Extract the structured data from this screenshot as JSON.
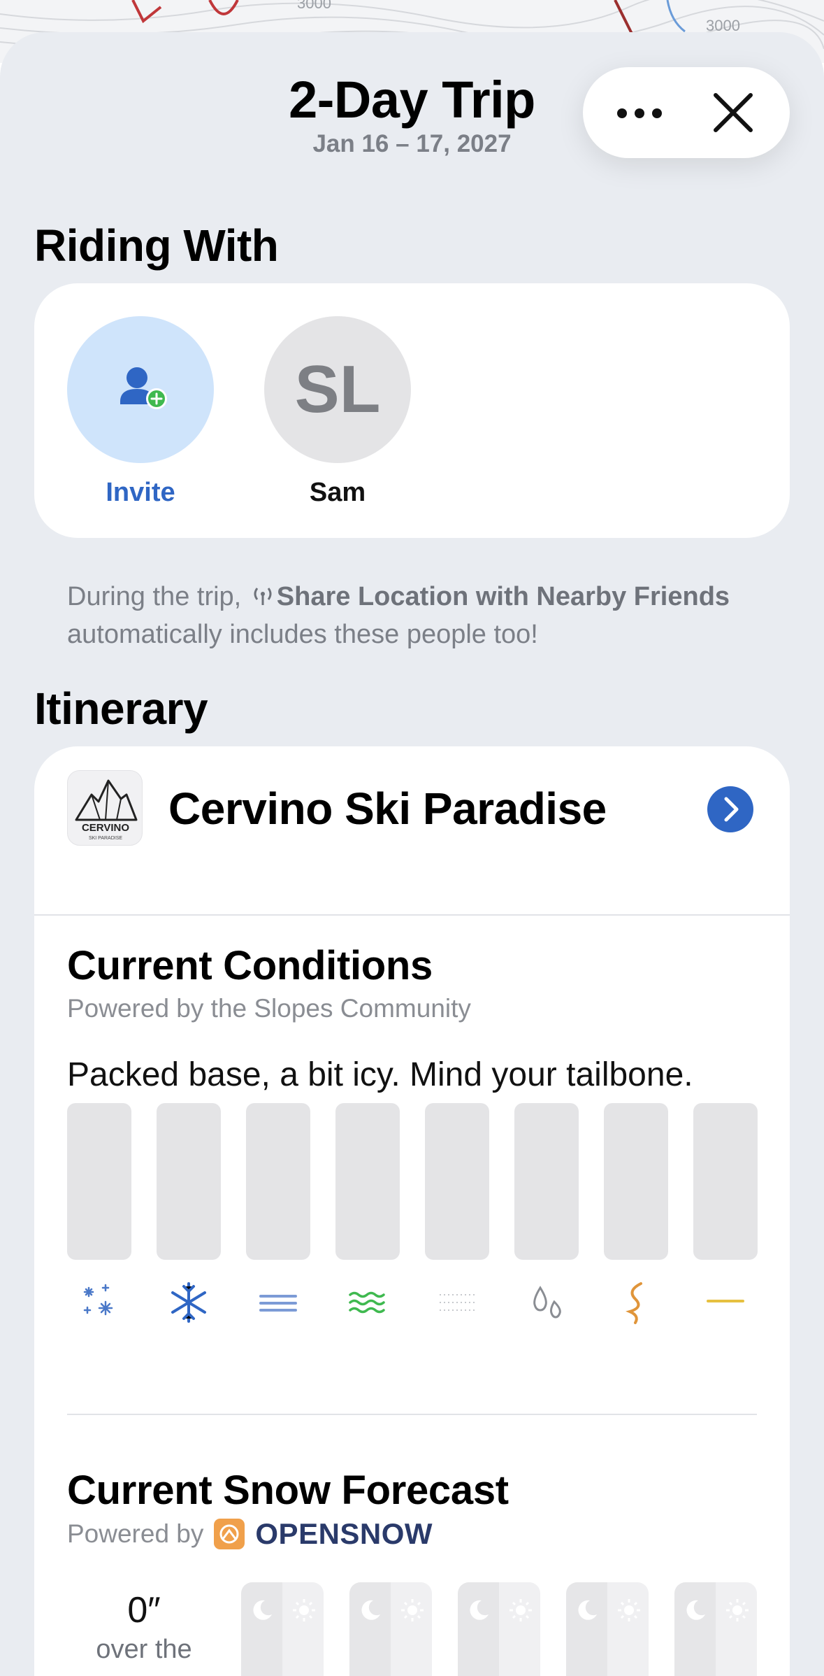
{
  "map": {
    "label_left": "3000",
    "label_right": "3000"
  },
  "header": {
    "title": "2-Day Trip",
    "dates": "Jan 16 – 17, 2027",
    "more_icon": "ellipsis-icon",
    "close_icon": "close-icon"
  },
  "riding_with": {
    "title": "Riding With",
    "invite": {
      "label": "Invite",
      "icon": "person-add-icon"
    },
    "people": [
      {
        "initials": "SL",
        "name": "Sam"
      }
    ],
    "note_prefix": "During the trip, ",
    "note_bold": "Share Location with Nearby Friends",
    "note_suffix": " automatically includes these people too!"
  },
  "itinerary": {
    "title": "Itinerary",
    "resort": {
      "name": "Cervino Ski Paradise",
      "logo_text": "CERVINO",
      "logo_subtext": "SKI PARADISE"
    },
    "conditions": {
      "title": "Current Conditions",
      "caption": "Powered by the Slopes Community",
      "report": "Packed base, a bit icy. Mind your tailbone.",
      "icons": [
        "powder-icon",
        "snowflake-icon",
        "groomed-icon",
        "wavy-icon",
        "dotted-icon",
        "wet-drops-icon",
        "slush-icon",
        "ice-line-icon"
      ]
    },
    "forecast": {
      "title": "Current Snow Forecast",
      "caption_prefix": "Powered by",
      "brand": "OPENSNOW",
      "total_value": "0″",
      "total_label": "over the"
    }
  },
  "colors": {
    "accent": "#2f66c4",
    "invite_bg": "#cfe4fb",
    "sheet_bg": "#e9ecf1",
    "opensnow_orange": "#f0a04b",
    "opensnow_navy": "#2a3a6a"
  }
}
